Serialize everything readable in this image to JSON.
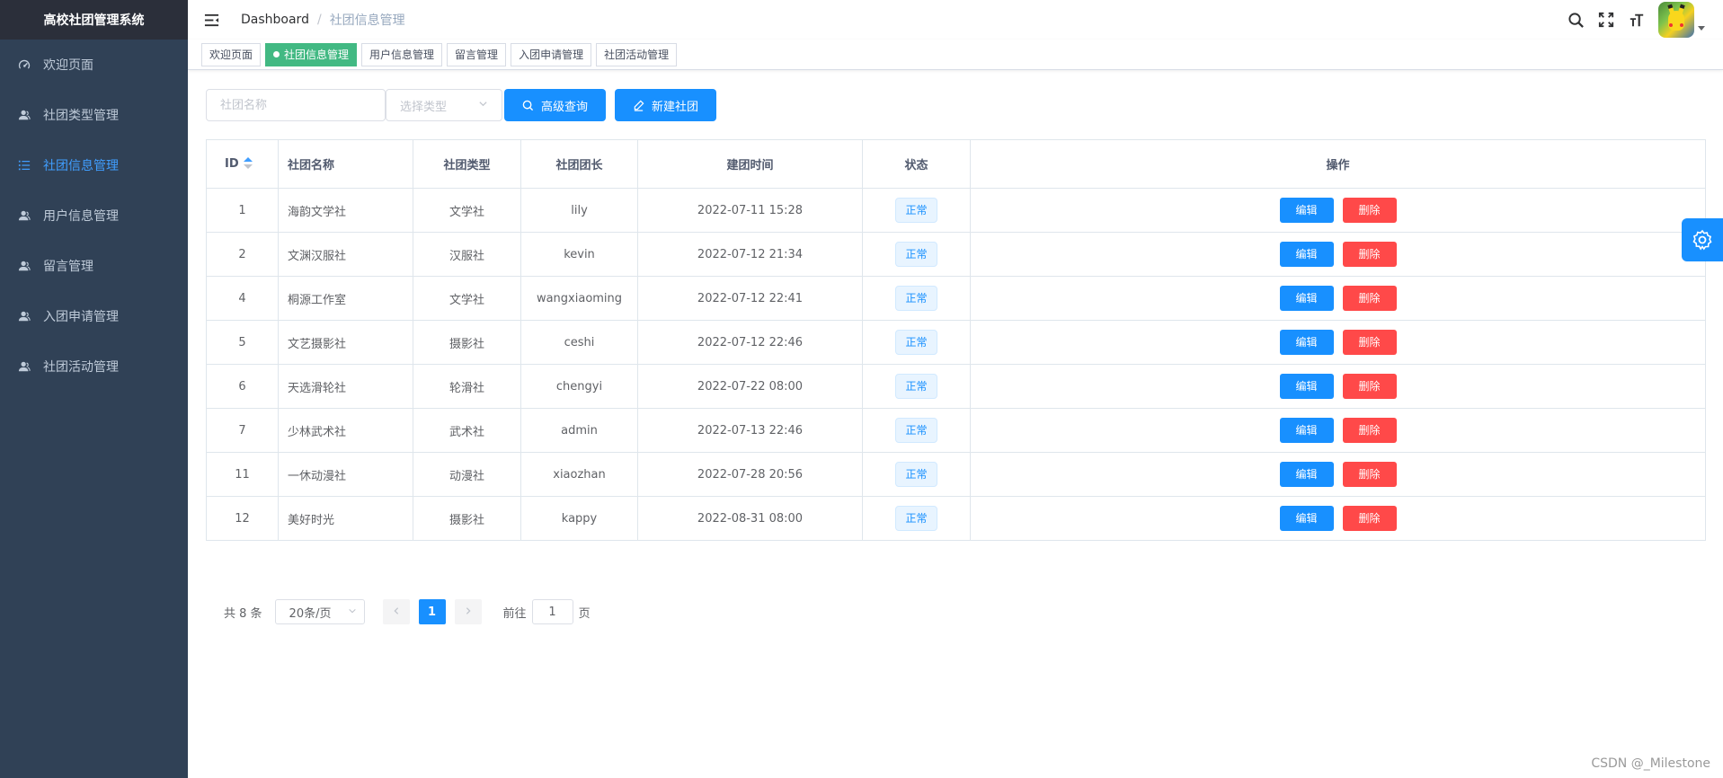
{
  "app": {
    "title": "高校社团管理系统"
  },
  "sidebar": {
    "items": [
      {
        "label": "欢迎页面",
        "icon": "dashboard-icon",
        "active": false
      },
      {
        "label": "社团类型管理",
        "icon": "user-icon",
        "active": false
      },
      {
        "label": "社团信息管理",
        "icon": "list-icon",
        "active": true
      },
      {
        "label": "用户信息管理",
        "icon": "user-icon",
        "active": false
      },
      {
        "label": "留言管理",
        "icon": "user-icon",
        "active": false
      },
      {
        "label": "入团申请管理",
        "icon": "user-icon",
        "active": false
      },
      {
        "label": "社团活动管理",
        "icon": "user-icon",
        "active": false
      }
    ]
  },
  "breadcrumb": {
    "home": "Dashboard",
    "separator": "/",
    "current": "社团信息管理"
  },
  "tags": [
    {
      "label": "欢迎页面",
      "active": false
    },
    {
      "label": "社团信息管理",
      "active": true
    },
    {
      "label": "用户信息管理",
      "active": false
    },
    {
      "label": "留言管理",
      "active": false
    },
    {
      "label": "入团申请管理",
      "active": false
    },
    {
      "label": "社团活动管理",
      "active": false
    }
  ],
  "filter": {
    "name_placeholder": "社团名称",
    "type_placeholder": "选择类型",
    "search_label": "高级查询",
    "create_label": "新建社团"
  },
  "table": {
    "headers": {
      "id": "ID",
      "name": "社团名称",
      "type": "社团类型",
      "leader": "社团团长",
      "created": "建团时间",
      "status": "状态",
      "ops": "操作"
    },
    "rows": [
      {
        "id": "1",
        "name": "海韵文学社",
        "type": "文学社",
        "leader": "lily",
        "created": "2022-07-11 15:28",
        "status": "正常"
      },
      {
        "id": "2",
        "name": "文渊汉服社",
        "type": "汉服社",
        "leader": "kevin",
        "created": "2022-07-12 21:34",
        "status": "正常"
      },
      {
        "id": "4",
        "name": "桐源工作室",
        "type": "文学社",
        "leader": "wangxiaoming",
        "created": "2022-07-12 22:41",
        "status": "正常"
      },
      {
        "id": "5",
        "name": "文艺摄影社",
        "type": "摄影社",
        "leader": "ceshi",
        "created": "2022-07-12 22:46",
        "status": "正常"
      },
      {
        "id": "6",
        "name": "天选滑轮社",
        "type": "轮滑社",
        "leader": "chengyi",
        "created": "2022-07-22 08:00",
        "status": "正常"
      },
      {
        "id": "7",
        "name": "少林武术社",
        "type": "武术社",
        "leader": "admin",
        "created": "2022-07-13 22:46",
        "status": "正常"
      },
      {
        "id": "11",
        "name": "一休动漫社",
        "type": "动漫社",
        "leader": "xiaozhan",
        "created": "2022-07-28 20:56",
        "status": "正常"
      },
      {
        "id": "12",
        "name": "美好时光",
        "type": "摄影社",
        "leader": "kappy",
        "created": "2022-08-31 08:00",
        "status": "正常"
      }
    ],
    "edit_label": "编辑",
    "delete_label": "删除"
  },
  "pagination": {
    "total": "共 8 条",
    "page_size": "20条/页",
    "current_page": "1",
    "goto_prefix": "前往",
    "goto_value": "1",
    "goto_suffix": "页"
  },
  "watermark": "CSDN @_Milestone",
  "colors": {
    "sidebar_bg": "#304156",
    "primary": "#1890ff",
    "danger": "#ff4949",
    "tag_active": "#42b983",
    "menu_active": "#409eff"
  }
}
